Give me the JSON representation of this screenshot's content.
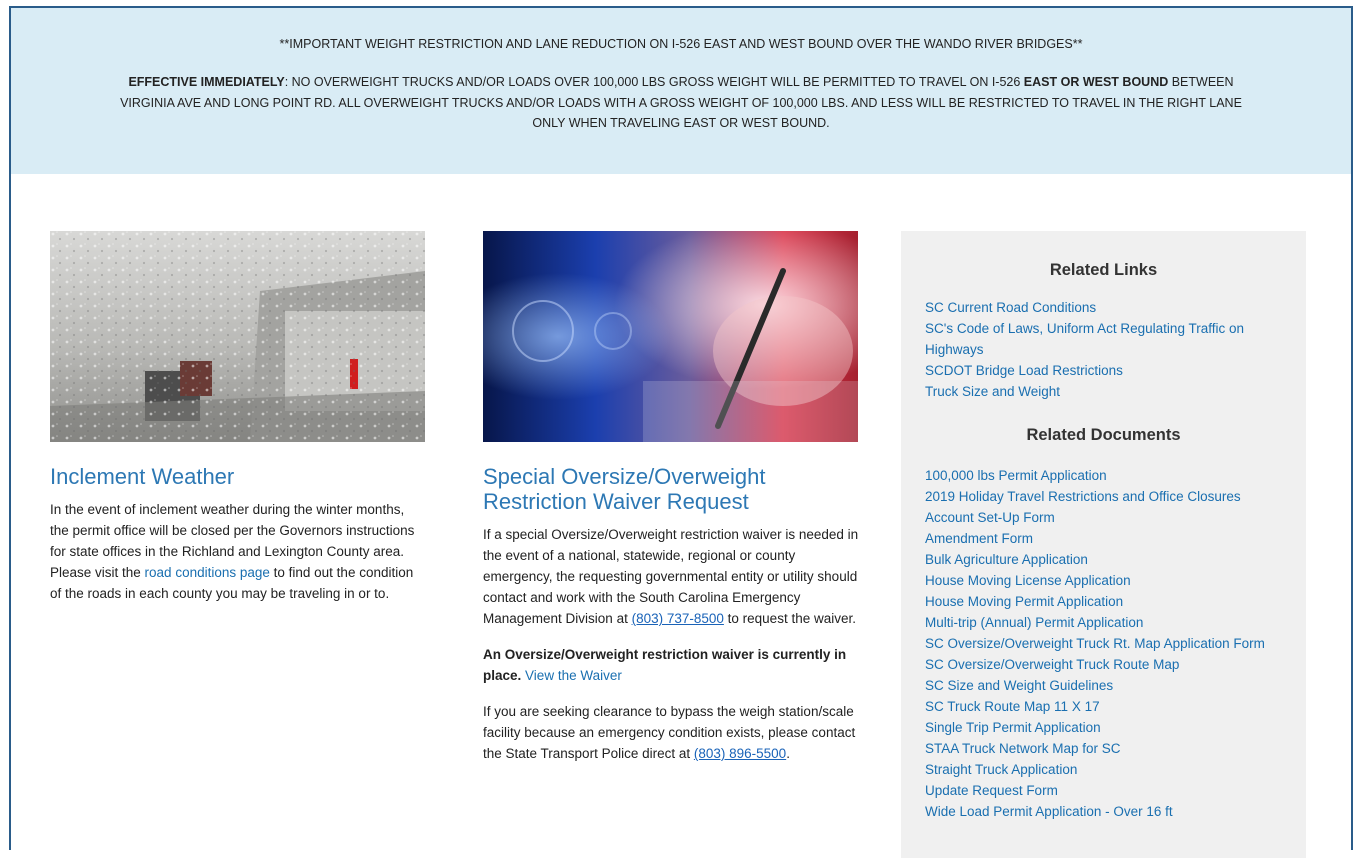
{
  "alert": {
    "headline": "**IMPORTANT WEIGHT RESTRICTION AND LANE REDUCTION ON I-526 EAST AND WEST BOUND OVER THE WANDO RIVER BRIDGES**",
    "effective_label": "EFFECTIVE IMMEDIATELY",
    "text_1": ": NO OVERWEIGHT TRUCKS AND/OR LOADS OVER 100,000 LBS GROSS WEIGHT WILL BE PERMITTED TO TRAVEL ON I-526 ",
    "bold_2": "EAST OR WEST BOUND",
    "text_2": " BETWEEN VIRGINIA AVE AND LONG POINT RD. ALL OVERWEIGHT TRUCKS AND/OR LOADS WITH A GROSS WEIGHT OF 100,000 LBS. AND LESS WILL BE RESTRICTED TO TRAVEL IN THE RIGHT LANE ONLY WHEN TRAVELING EAST OR WEST BOUND."
  },
  "weather": {
    "title": "Inclement Weather",
    "text_before": "In the event of inclement weather during the winter months, the permit office will be closed per the Governors instructions for state offices in the Richland and Lexington County area. Please visit the ",
    "link": "road conditions page",
    "text_after": " to find out the condition of the roads in each county you may be traveling in or to."
  },
  "waiver": {
    "title": "Special Oversize/Overweight Restriction Waiver Request",
    "p1_before": "If a special Oversize/Overweight restriction waiver is needed in the event of a national, statewide, regional or county emergency, the requesting governmental entity or utility should contact and work with the South Carolina Emergency Management Division at ",
    "p1_phone": "(803) 737-8500",
    "p1_after": " to request the waiver.",
    "p2_bold": "An Oversize/Overweight restriction waiver is currently in place.",
    "p2_link": "View the Waiver",
    "p3_before": "If you are seeking clearance to bypass the weigh station/scale facility because an emergency condition exists, please contact the State Transport Police direct at ",
    "p3_phone": "(803) 896-5500",
    "p3_after": "."
  },
  "sidebar": {
    "links_heading": "Related Links",
    "links": [
      "SC Current Road Conditions",
      "SC's Code of Laws, Uniform Act Regulating Traffic on Highways",
      "SCDOT Bridge Load Restrictions",
      "Truck Size and Weight"
    ],
    "docs_heading": "Related Documents",
    "docs": [
      "100,000 lbs Permit Application",
      "2019 Holiday Travel Restrictions and Office Closures",
      "Account Set-Up Form",
      "Amendment Form",
      "Bulk Agriculture Application",
      "House Moving License Application",
      "House Moving Permit Application",
      "Multi-trip (Annual) Permit Application",
      "SC Oversize/Overweight Truck Rt. Map Application Form",
      "SC Oversize/Overweight Truck Route Map",
      "SC Size and Weight Guidelines",
      "SC Truck Route Map 11 X 17",
      "Single Trip Permit Application",
      "STAA Truck Network Map for SC",
      "Straight Truck Application",
      "Update Request Form",
      "Wide Load Permit Application - Over 16 ft"
    ]
  }
}
